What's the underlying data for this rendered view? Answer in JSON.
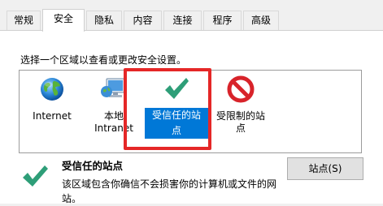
{
  "tabs": [
    "常规",
    "安全",
    "隐私",
    "内容",
    "连接",
    "程序",
    "高级"
  ],
  "active_tab": "安全",
  "instruction": "选择一个区域以查看或更改安全设置。",
  "zones": [
    {
      "line1": "Internet",
      "line2": "",
      "icon": "globe-icon"
    },
    {
      "line1": "本地",
      "line2": "Intranet",
      "icon": "computer-network-icon"
    },
    {
      "line1": "受信任的站",
      "line2": "点",
      "icon": "checkmark-icon",
      "selected": true
    },
    {
      "line1": "受限制的站",
      "line2": "点",
      "icon": "forbidden-icon"
    }
  ],
  "selected_zone": {
    "title": "受信任的站点",
    "description": "该区域包含你确信不会损害你的计算机或文件的网站。"
  },
  "sites_button_label": "站点(S)",
  "colors": {
    "selection": "#0078d7",
    "highlight": "#e52727",
    "check_green": "#2e9e78"
  }
}
